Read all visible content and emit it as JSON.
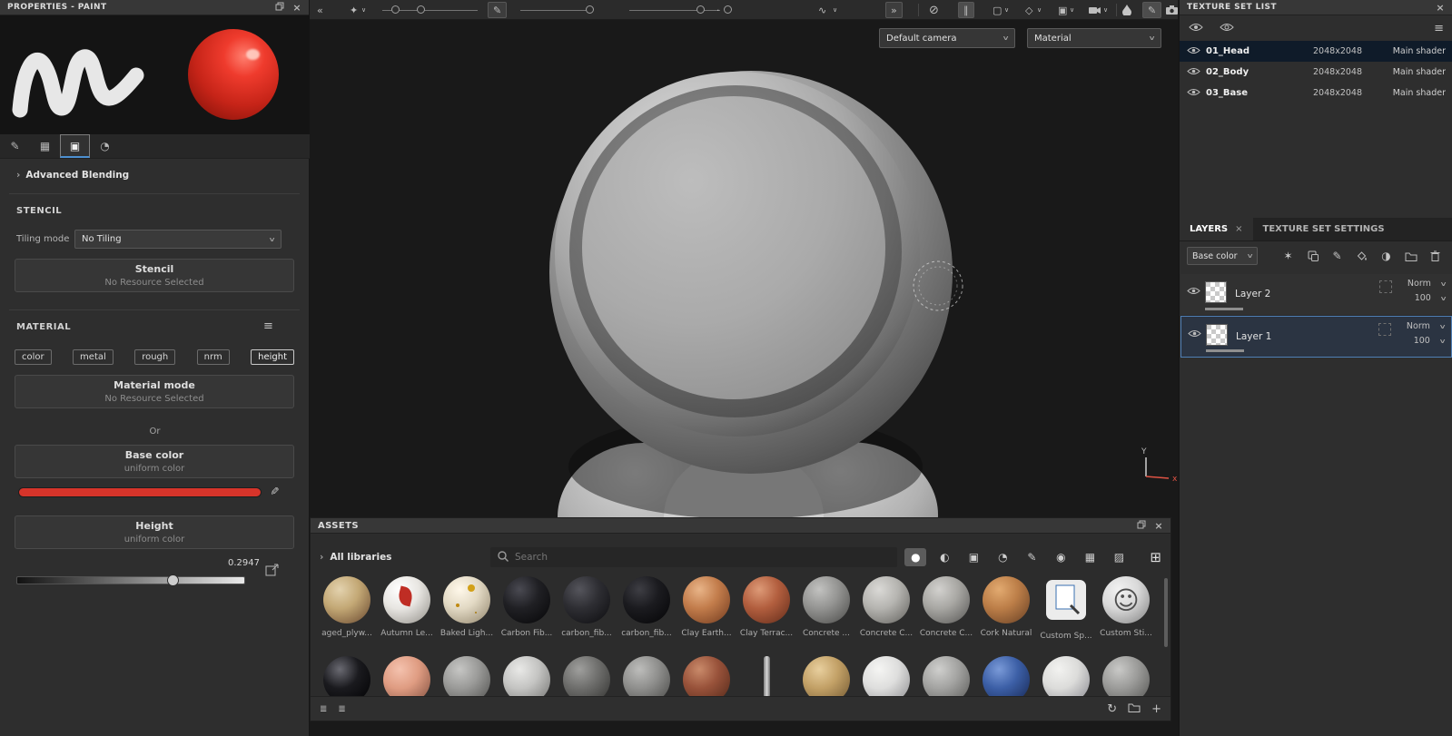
{
  "icons": {
    "collapse_left": "«",
    "expand_right": "»",
    "chevron_right": "›",
    "chevron_down": "∨",
    "close": "×",
    "menu": "≡",
    "brush": "✎",
    "stencil_grid": "▦",
    "material_square": "▣",
    "sphere": "◔",
    "physics": "✦",
    "wave": "∿",
    "no_symbol": "⊘",
    "pause": "∥",
    "plane": "▢",
    "shape": "◇",
    "cube": "▣",
    "wand": "✶",
    "half_sphere": "◑",
    "plus": "+",
    "refresh": "↻",
    "list": "≣",
    "grid": "⊞",
    "dot": "·",
    "circle": "○",
    "filled_circle": "●",
    "half_circle": "◐",
    "hatch_square": "▨",
    "quarter": "◔",
    "donut": "◉"
  },
  "colors": {
    "accent": "#4c8fd0",
    "swatch_red": "#d6342a",
    "selected_row": "#0f1b29"
  },
  "properties": {
    "title": "PROPERTIES - PAINT",
    "advanced_blending": "Advanced Blending",
    "stencil_heading": "STENCIL",
    "tiling_mode_label": "Tiling mode",
    "tiling_mode_value": "No Tiling",
    "stencil_button_title": "Stencil",
    "stencil_button_sub": "No Resource Selected",
    "material_heading": "MATERIAL",
    "channels": [
      "color",
      "metal",
      "rough",
      "nrm",
      "height"
    ],
    "material_mode_title": "Material mode",
    "material_mode_sub": "No Resource Selected",
    "or_label": "Or",
    "base_color_title": "Base color",
    "base_color_sub": "uniform color",
    "height_title": "Height",
    "height_sub": "uniform color",
    "height_value": "0.2947"
  },
  "viewport": {
    "camera_select": "Default camera",
    "shading_select": "Material",
    "gizmo_y": "Y",
    "gizmo_x": "x"
  },
  "texture_sets": {
    "title": "TEXTURE SET LIST",
    "rows": [
      {
        "name": "01_Head",
        "resolution": "2048x2048",
        "shader": "Main shader"
      },
      {
        "name": "02_Body",
        "resolution": "2048x2048",
        "shader": "Main shader"
      },
      {
        "name": "03_Base",
        "resolution": "2048x2048",
        "shader": "Main shader"
      }
    ]
  },
  "layers": {
    "tab_layers": "LAYERS",
    "tab_settings": "TEXTURE SET SETTINGS",
    "channel_select": "Base color",
    "items": [
      {
        "name": "Layer 2",
        "blend": "Norm",
        "opacity": "100"
      },
      {
        "name": "Layer 1",
        "blend": "Norm",
        "opacity": "100"
      }
    ]
  },
  "assets": {
    "title": "ASSETS",
    "library_label": "All libraries",
    "search_placeholder": "Search",
    "row1": [
      {
        "label": "aged_plyw...",
        "hi": "#e3d2ae",
        "c1": "#c3a875",
        "c2": "#77573a"
      },
      {
        "label": "Autumn Le...",
        "hi": "#ffffff",
        "c1": "#e8e6e2",
        "c2": "#9f9c96",
        "leaf": true
      },
      {
        "label": "Baked Ligh...",
        "hi": "#fff8ea",
        "c1": "#e2d9c4",
        "c2": "#9d9179",
        "spots": true
      },
      {
        "label": "Carbon Fib...",
        "hi": "#4a4a52",
        "c1": "#202024",
        "c2": "#0a0a0c"
      },
      {
        "label": "carbon_fib...",
        "hi": "#55555c",
        "c1": "#2e2e33",
        "c2": "#121215"
      },
      {
        "label": "carbon_fib...",
        "hi": "#3e3e44",
        "c1": "#1b1b1f",
        "c2": "#08080a"
      },
      {
        "label": "Clay Earth...",
        "hi": "#e8b488",
        "c1": "#c27c4b",
        "c2": "#7e4526"
      },
      {
        "label": "Clay Terrac...",
        "hi": "#dd9a77",
        "c1": "#b25e3e",
        "c2": "#6f3420"
      },
      {
        "label": "Concrete ...",
        "hi": "#c2c2c0",
        "c1": "#949492",
        "c2": "#565654"
      },
      {
        "label": "Concrete C...",
        "hi": "#dad9d6",
        "c1": "#b5b4b0",
        "c2": "#6f6e6a"
      },
      {
        "label": "Concrete C...",
        "hi": "#d2d1ce",
        "c1": "#a8a7a3",
        "c2": "#636260"
      },
      {
        "label": "Cork Natural",
        "hi": "#e2aa70",
        "c1": "#bc7e48",
        "c2": "#74492a"
      },
      {
        "label": "Custom Sp...",
        "shape": "stamp"
      },
      {
        "label": "Custom Sti...",
        "hi": "#f2f2f2",
        "c1": "#d9d9d9",
        "c2": "#8f8f8f",
        "face": true
      }
    ],
    "row2": [
      {
        "hi": "#6a6a72",
        "c1": "#1a1a1e",
        "c2": "#050507"
      },
      {
        "hi": "#f4c2ae",
        "c1": "#df9c82",
        "c2": "#8e5a48"
      },
      {
        "hi": "#c6c6c4",
        "c1": "#9a9a98",
        "c2": "#5a5a58"
      },
      {
        "hi": "#e9e9e7",
        "c1": "#c4c4c2",
        "c2": "#7e7e7c"
      },
      {
        "hi": "#9f9f9d",
        "c1": "#6e6e6c",
        "c2": "#3a3a38"
      },
      {
        "hi": "#bdbdbb",
        "c1": "#8f8f8d",
        "c2": "#525250"
      },
      {
        "hi": "#c98a6a",
        "c1": "#98523a",
        "c2": "#5c2e1e"
      },
      {
        "shape": "sliver",
        "c1": "#d8d8d8"
      },
      {
        "hi": "#e8cf9e",
        "c1": "#c2a066",
        "c2": "#7c6138"
      },
      {
        "hi": "#f5f5f3",
        "c1": "#dededd",
        "c2": "#98989a"
      },
      {
        "hi": "#cfcfcd",
        "c1": "#a3a3a1",
        "c2": "#646462"
      },
      {
        "hi": "#7a9ad8",
        "c1": "#3c5fa6",
        "c2": "#1c2f5e"
      },
      {
        "hi": "#f2f2f0",
        "c1": "#dcdcda",
        "c2": "#94949a"
      },
      {
        "hi": "#c9c9c7",
        "c1": "#9b9b99",
        "c2": "#5e5e5c"
      },
      {
        "hi": "#b8b8b6",
        "c1": "#8a8a88",
        "c2": "#4e4e4c"
      }
    ]
  }
}
